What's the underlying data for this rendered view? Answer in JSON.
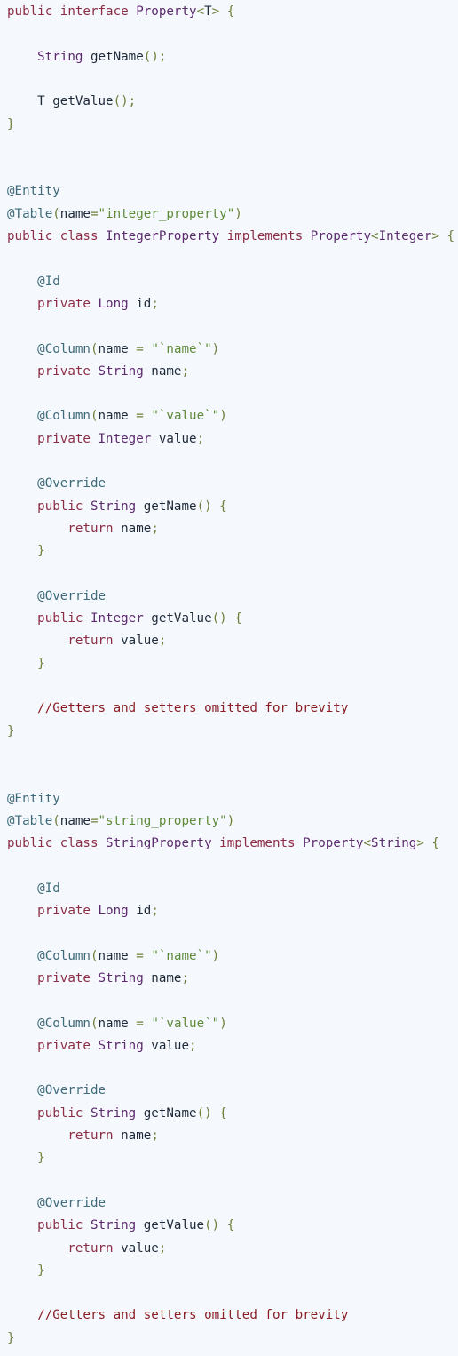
{
  "colors": {
    "background": "#f5f8fc",
    "plain": "#1e2a3a",
    "keyword": "#8c2d45",
    "type": "#5c2a6e",
    "annotation": "#3e6a7a",
    "string": "#5e8a3a",
    "comment": "#8a1e24",
    "punctuation": "#6f7f3a"
  },
  "lines": [
    [
      [
        "keyword",
        "public interface "
      ],
      [
        "type",
        "Property"
      ],
      [
        "punct",
        "<"
      ],
      [
        "plain",
        "T"
      ],
      [
        "punct",
        "> {"
      ]
    ],
    [],
    [
      [
        "plain",
        "    "
      ],
      [
        "type",
        "String"
      ],
      [
        "plain",
        " getName"
      ],
      [
        "punct",
        "();"
      ]
    ],
    [],
    [
      [
        "plain",
        "    T getValue"
      ],
      [
        "punct",
        "();"
      ]
    ],
    [
      [
        "punct",
        "}"
      ]
    ],
    [],
    [],
    [
      [
        "anno",
        "@Entity"
      ]
    ],
    [
      [
        "anno",
        "@Table"
      ],
      [
        "punct",
        "("
      ],
      [
        "plain",
        "name"
      ],
      [
        "punct",
        "="
      ],
      [
        "string",
        "\"integer_property\""
      ],
      [
        "punct",
        ")"
      ]
    ],
    [
      [
        "keyword",
        "public class "
      ],
      [
        "type",
        "IntegerProperty"
      ],
      [
        "keyword",
        " implements "
      ],
      [
        "type",
        "Property"
      ],
      [
        "punct",
        "<"
      ],
      [
        "type",
        "Integer"
      ],
      [
        "punct",
        "> {"
      ]
    ],
    [],
    [
      [
        "plain",
        "    "
      ],
      [
        "anno",
        "@Id"
      ]
    ],
    [
      [
        "plain",
        "    "
      ],
      [
        "keyword",
        "private "
      ],
      [
        "type",
        "Long"
      ],
      [
        "plain",
        " id"
      ],
      [
        "punct",
        ";"
      ]
    ],
    [],
    [
      [
        "plain",
        "    "
      ],
      [
        "anno",
        "@Column"
      ],
      [
        "punct",
        "("
      ],
      [
        "plain",
        "name "
      ],
      [
        "punct",
        "= "
      ],
      [
        "string",
        "\"`name`\""
      ],
      [
        "punct",
        ")"
      ]
    ],
    [
      [
        "plain",
        "    "
      ],
      [
        "keyword",
        "private "
      ],
      [
        "type",
        "String"
      ],
      [
        "plain",
        " name"
      ],
      [
        "punct",
        ";"
      ]
    ],
    [],
    [
      [
        "plain",
        "    "
      ],
      [
        "anno",
        "@Column"
      ],
      [
        "punct",
        "("
      ],
      [
        "plain",
        "name "
      ],
      [
        "punct",
        "= "
      ],
      [
        "string",
        "\"`value`\""
      ],
      [
        "punct",
        ")"
      ]
    ],
    [
      [
        "plain",
        "    "
      ],
      [
        "keyword",
        "private "
      ],
      [
        "type",
        "Integer"
      ],
      [
        "plain",
        " value"
      ],
      [
        "punct",
        ";"
      ]
    ],
    [],
    [
      [
        "plain",
        "    "
      ],
      [
        "anno",
        "@Override"
      ]
    ],
    [
      [
        "plain",
        "    "
      ],
      [
        "keyword",
        "public "
      ],
      [
        "type",
        "String"
      ],
      [
        "plain",
        " getName"
      ],
      [
        "punct",
        "() {"
      ]
    ],
    [
      [
        "plain",
        "        "
      ],
      [
        "keyword",
        "return "
      ],
      [
        "plain",
        "name"
      ],
      [
        "punct",
        ";"
      ]
    ],
    [
      [
        "plain",
        "    "
      ],
      [
        "punct",
        "}"
      ]
    ],
    [],
    [
      [
        "plain",
        "    "
      ],
      [
        "anno",
        "@Override"
      ]
    ],
    [
      [
        "plain",
        "    "
      ],
      [
        "keyword",
        "public "
      ],
      [
        "type",
        "Integer"
      ],
      [
        "plain",
        " getValue"
      ],
      [
        "punct",
        "() {"
      ]
    ],
    [
      [
        "plain",
        "        "
      ],
      [
        "keyword",
        "return "
      ],
      [
        "plain",
        "value"
      ],
      [
        "punct",
        ";"
      ]
    ],
    [
      [
        "plain",
        "    "
      ],
      [
        "punct",
        "}"
      ]
    ],
    [],
    [
      [
        "plain",
        "    "
      ],
      [
        "comment",
        "//Getters and setters omitted for brevity"
      ]
    ],
    [
      [
        "punct",
        "}"
      ]
    ],
    [],
    [],
    [
      [
        "anno",
        "@Entity"
      ]
    ],
    [
      [
        "anno",
        "@Table"
      ],
      [
        "punct",
        "("
      ],
      [
        "plain",
        "name"
      ],
      [
        "punct",
        "="
      ],
      [
        "string",
        "\"string_property\""
      ],
      [
        "punct",
        ")"
      ]
    ],
    [
      [
        "keyword",
        "public class "
      ],
      [
        "type",
        "StringProperty"
      ],
      [
        "keyword",
        " implements "
      ],
      [
        "type",
        "Property"
      ],
      [
        "punct",
        "<"
      ],
      [
        "type",
        "String"
      ],
      [
        "punct",
        "> {"
      ]
    ],
    [],
    [
      [
        "plain",
        "    "
      ],
      [
        "anno",
        "@Id"
      ]
    ],
    [
      [
        "plain",
        "    "
      ],
      [
        "keyword",
        "private "
      ],
      [
        "type",
        "Long"
      ],
      [
        "plain",
        " id"
      ],
      [
        "punct",
        ";"
      ]
    ],
    [],
    [
      [
        "plain",
        "    "
      ],
      [
        "anno",
        "@Column"
      ],
      [
        "punct",
        "("
      ],
      [
        "plain",
        "name "
      ],
      [
        "punct",
        "= "
      ],
      [
        "string",
        "\"`name`\""
      ],
      [
        "punct",
        ")"
      ]
    ],
    [
      [
        "plain",
        "    "
      ],
      [
        "keyword",
        "private "
      ],
      [
        "type",
        "String"
      ],
      [
        "plain",
        " name"
      ],
      [
        "punct",
        ";"
      ]
    ],
    [],
    [
      [
        "plain",
        "    "
      ],
      [
        "anno",
        "@Column"
      ],
      [
        "punct",
        "("
      ],
      [
        "plain",
        "name "
      ],
      [
        "punct",
        "= "
      ],
      [
        "string",
        "\"`value`\""
      ],
      [
        "punct",
        ")"
      ]
    ],
    [
      [
        "plain",
        "    "
      ],
      [
        "keyword",
        "private "
      ],
      [
        "type",
        "String"
      ],
      [
        "plain",
        " value"
      ],
      [
        "punct",
        ";"
      ]
    ],
    [],
    [
      [
        "plain",
        "    "
      ],
      [
        "anno",
        "@Override"
      ]
    ],
    [
      [
        "plain",
        "    "
      ],
      [
        "keyword",
        "public "
      ],
      [
        "type",
        "String"
      ],
      [
        "plain",
        " getName"
      ],
      [
        "punct",
        "() {"
      ]
    ],
    [
      [
        "plain",
        "        "
      ],
      [
        "keyword",
        "return "
      ],
      [
        "plain",
        "name"
      ],
      [
        "punct",
        ";"
      ]
    ],
    [
      [
        "plain",
        "    "
      ],
      [
        "punct",
        "}"
      ]
    ],
    [],
    [
      [
        "plain",
        "    "
      ],
      [
        "anno",
        "@Override"
      ]
    ],
    [
      [
        "plain",
        "    "
      ],
      [
        "keyword",
        "public "
      ],
      [
        "type",
        "String"
      ],
      [
        "plain",
        " getValue"
      ],
      [
        "punct",
        "() {"
      ]
    ],
    [
      [
        "plain",
        "        "
      ],
      [
        "keyword",
        "return "
      ],
      [
        "plain",
        "value"
      ],
      [
        "punct",
        ";"
      ]
    ],
    [
      [
        "plain",
        "    "
      ],
      [
        "punct",
        "}"
      ]
    ],
    [],
    [
      [
        "plain",
        "    "
      ],
      [
        "comment",
        "//Getters and setters omitted for brevity"
      ]
    ],
    [
      [
        "punct",
        "}"
      ]
    ]
  ]
}
